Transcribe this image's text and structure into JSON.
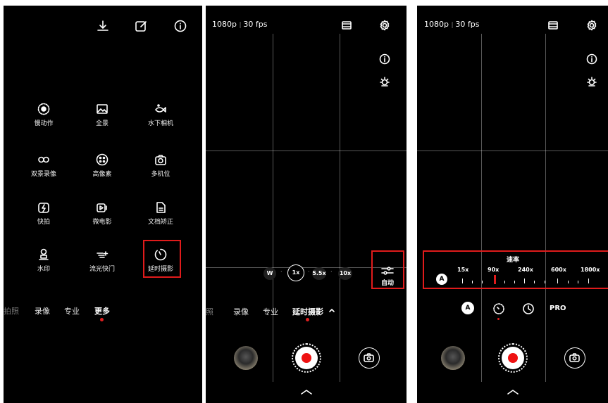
{
  "panel1": {
    "modes": [
      {
        "label": "慢动作",
        "icon": "slow-motion-icon"
      },
      {
        "label": "全景",
        "icon": "panorama-icon"
      },
      {
        "label": "水下相机",
        "icon": "underwater-camera-icon"
      },
      {
        "label": "双景录像",
        "icon": "dual-view-icon"
      },
      {
        "label": "高像素",
        "icon": "high-resolution-icon"
      },
      {
        "label": "多机位",
        "icon": "multi-camera-icon"
      },
      {
        "label": "快拍",
        "icon": "quick-snap-icon"
      },
      {
        "label": "微电影",
        "icon": "micro-movie-icon"
      },
      {
        "label": "文档矫正",
        "icon": "document-correction-icon"
      },
      {
        "label": "水印",
        "icon": "watermark-icon"
      },
      {
        "label": "流光快门",
        "icon": "light-painting-icon"
      },
      {
        "label": "延时摄影",
        "icon": "timelapse-icon"
      }
    ],
    "tabs": [
      "拍照",
      "录像",
      "专业",
      "更多"
    ],
    "active_tab": "更多"
  },
  "panel2": {
    "resolution": "1080p",
    "fps": "30 fps",
    "zoom": [
      "W",
      "1x",
      "5.5x",
      "10x"
    ],
    "auto_label": "自动",
    "tabs": [
      "录像",
      "专业",
      "延时摄影"
    ],
    "active_tab": "延时摄影"
  },
  "panel3": {
    "resolution": "1080p",
    "fps": "30 fps",
    "speed_title": "速率",
    "auto_badge": "A",
    "speeds": [
      "15x",
      "90x",
      "240x",
      "600x",
      "1800x"
    ],
    "selected_speed": "90x",
    "options": [
      "A",
      "PRO"
    ]
  },
  "colors": {
    "highlight": "#e01b1b",
    "record": "#e11111",
    "background": "#000000"
  }
}
